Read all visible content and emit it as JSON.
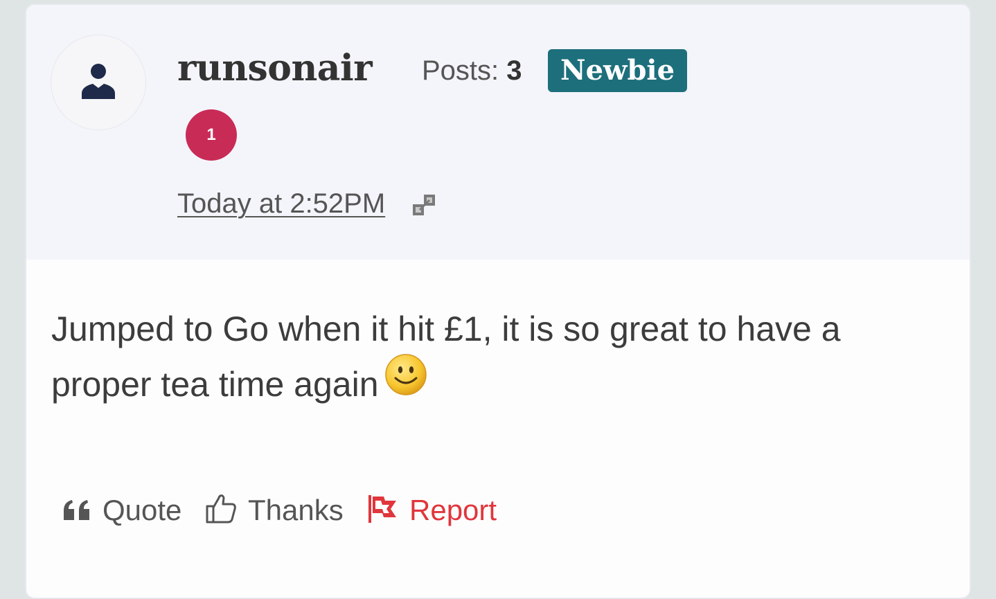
{
  "post": {
    "author": {
      "username": "runsonair",
      "posts_label": "Posts:",
      "posts_count": "3",
      "rank": "Newbie",
      "level": "1",
      "avatar_icon": "user-silhouette-icon"
    },
    "timestamp": "Today at 2:52PM",
    "body": "Jumped to Go when it hit £1, it is so great to have a proper tea time again",
    "emoji": "smiley-face-icon",
    "actions": {
      "quote": "Quote",
      "thanks": "Thanks",
      "report": "Report"
    }
  },
  "colors": {
    "header_bg": "#f4f5fa",
    "rank_badge": "#1d6f7c",
    "level_badge": "#c92b57",
    "report": "#e0363c",
    "text": "#3c3c3c"
  }
}
